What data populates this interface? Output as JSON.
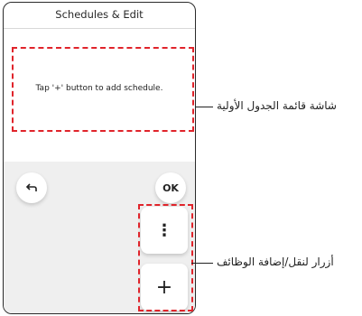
{
  "header": {
    "title": "Schedules & Edit"
  },
  "main": {
    "empty_message": "Tap '+' button to add schedule."
  },
  "controls": {
    "back_icon": "back-arrow-icon",
    "ok_label": "OK",
    "menu_label": "⋮",
    "add_label": "+"
  },
  "annotations": {
    "initial_screen": "شاشة قائمة الجدول الأولية",
    "function_buttons": "أزرار لنقل/إضافة الوظائف"
  },
  "colors": {
    "highlight": "#e0242b"
  }
}
